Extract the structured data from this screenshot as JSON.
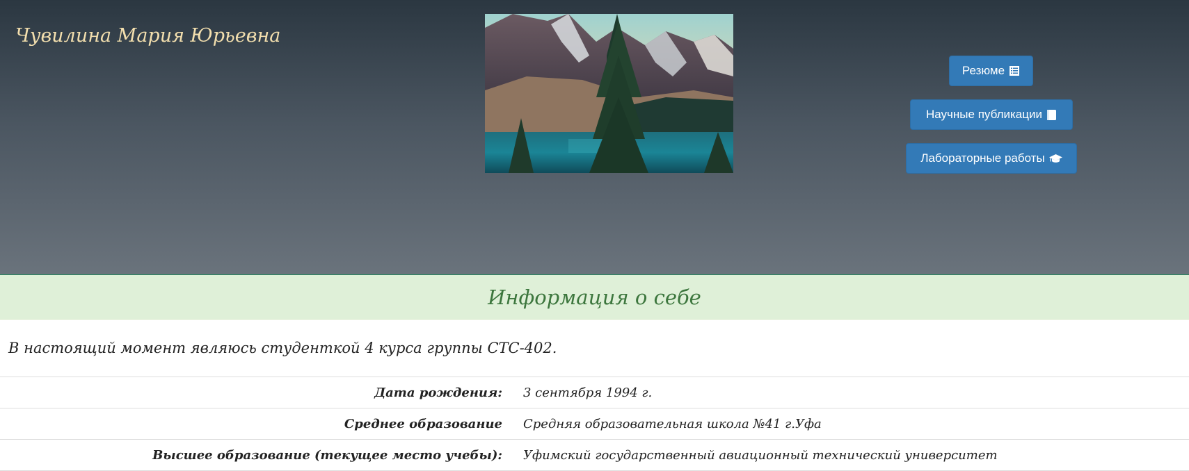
{
  "header": {
    "name": "Чувилина Мария Юрьевна",
    "photo_icon": "mountain-lake-photo",
    "buttons": [
      {
        "label": "Резюме",
        "icon": "list-alt-icon"
      },
      {
        "label": "Научные публикации",
        "icon": "book-icon"
      },
      {
        "label": "Лабораторные работы",
        "icon": "graduation-cap-icon"
      }
    ]
  },
  "info": {
    "title": "Информация о себе",
    "intro": "В настоящий момент являюсь студенткой 4 курса группы СТС-402.",
    "rows": [
      {
        "label": "Дата рождения:",
        "value": "3 сентября 1994 г."
      },
      {
        "label": "Среднее образование",
        "value": "Средняя образовательная школа №41 г.Уфа"
      },
      {
        "label": "Высшее образование (текущее место учебы):",
        "value": "Уфимский государственный авиационный технический университет"
      }
    ]
  },
  "colors": {
    "name_text": "#f3dfae",
    "button_bg": "#337ab7",
    "info_header_bg": "#dff0d8",
    "info_header_text": "#3c763d"
  }
}
